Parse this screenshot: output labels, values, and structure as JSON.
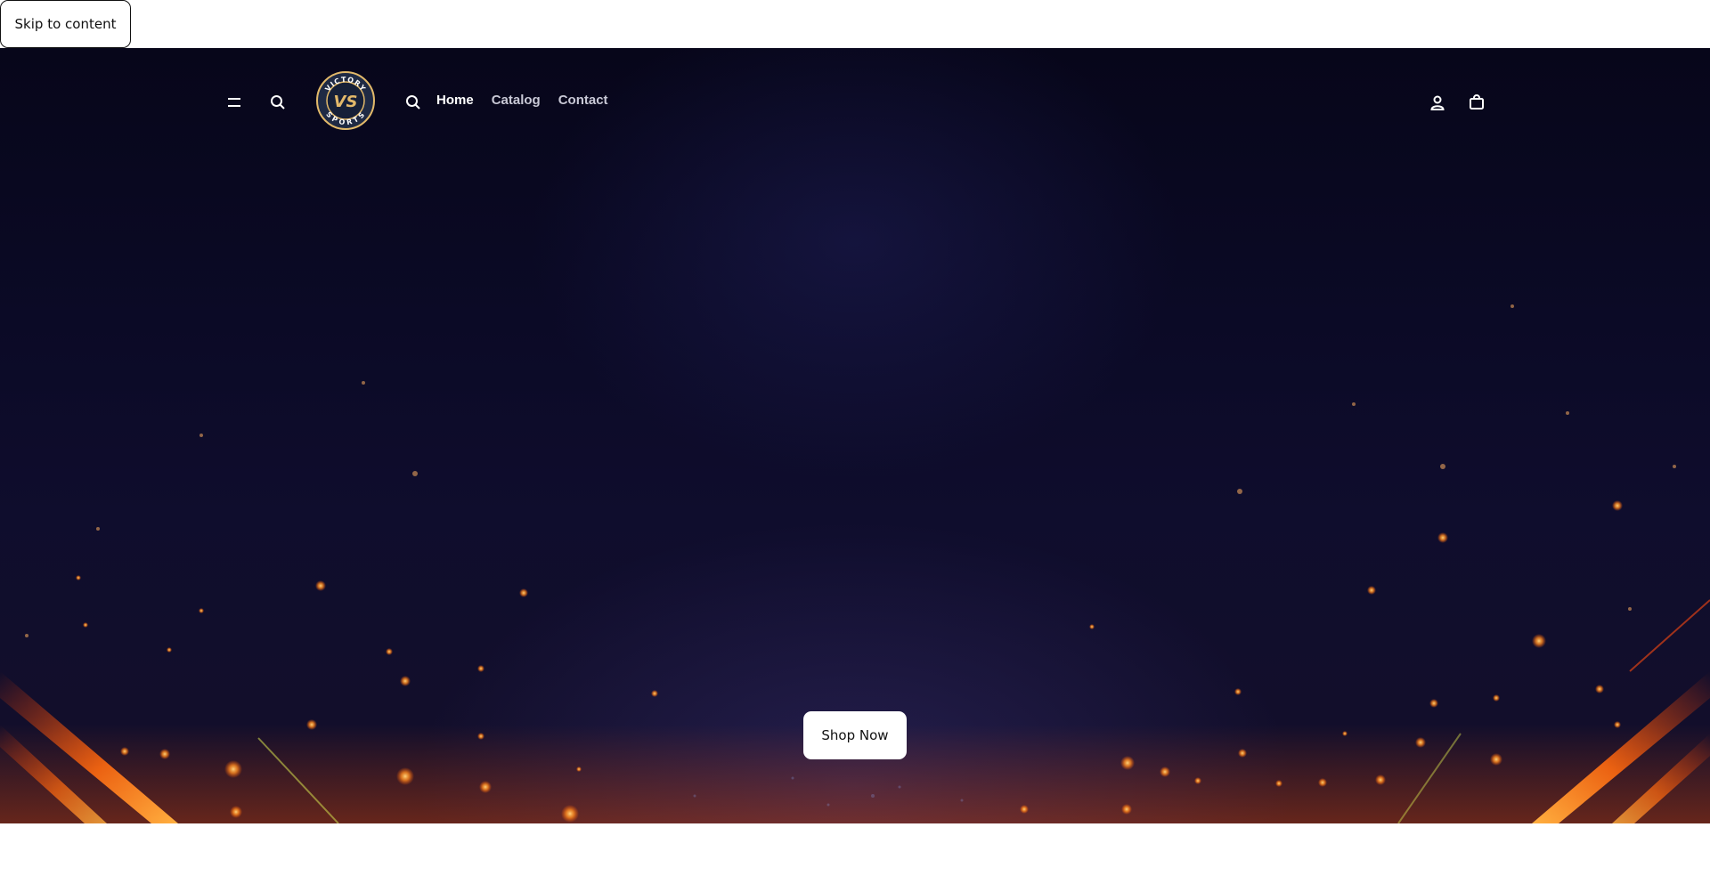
{
  "skip_link": {
    "label": "Skip to content"
  },
  "header": {
    "menu_icon": "hamburger-menu-icon",
    "search_icon": "search-icon",
    "logo": {
      "top_text": "VICTORY",
      "bottom_text": "SPORTS",
      "monogram": "VS"
    },
    "nav_search_icon": "search-icon",
    "nav": [
      {
        "label": "Home",
        "active": true
      },
      {
        "label": "Catalog",
        "active": false
      },
      {
        "label": "Contact",
        "active": false
      }
    ],
    "account_icon": "user-account-icon",
    "cart_icon": "shopping-bag-icon"
  },
  "hero": {
    "cta_label": "Shop Now"
  },
  "colors": {
    "hero_background": "#0b0a26",
    "accent_ember": "#ff8a1f",
    "text_white": "#ffffff"
  }
}
